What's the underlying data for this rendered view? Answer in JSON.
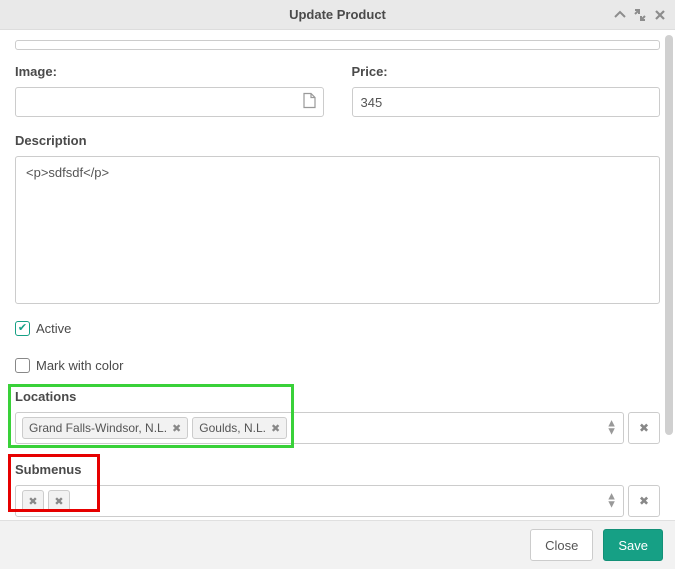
{
  "header": {
    "title": "Update Product"
  },
  "fields": {
    "image_label": "Image:",
    "image_value": "",
    "price_label": "Price:",
    "price_value": "345",
    "description_label": "Description",
    "description_value": "<p>sdfsdf</p>",
    "active_label": "Active",
    "active_checked": true,
    "mark_color_label": "Mark with color",
    "mark_color_checked": false
  },
  "locations": {
    "label": "Locations",
    "tags": [
      "Grand Falls-Windsor, N.L.",
      "Goulds, N.L."
    ]
  },
  "submenus": {
    "label": "Submenus",
    "tags": [
      "",
      ""
    ]
  },
  "footer": {
    "close_label": "Close",
    "save_label": "Save"
  }
}
